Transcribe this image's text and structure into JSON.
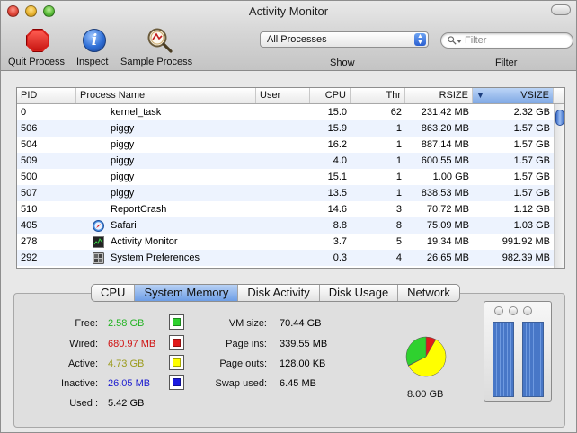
{
  "window": {
    "title": "Activity Monitor"
  },
  "toolbar": {
    "quit_label": "Quit Process",
    "inspect_label": "Inspect",
    "sample_label": "Sample Process",
    "show_selected": "All Processes",
    "show_label": "Show",
    "search_placeholder": "Filter",
    "filter_label": "Filter"
  },
  "table": {
    "columns": [
      "PID",
      "Process Name",
      "User",
      "CPU",
      "Thr",
      "RSIZE",
      "VSIZE"
    ],
    "sorted_column": "VSIZE",
    "rows": [
      {
        "pid": "0",
        "name": "kernel_task",
        "user": "",
        "cpu": "15.0",
        "thr": "62",
        "rsize": "231.42 MB",
        "vsize": "2.32 GB",
        "icon": ""
      },
      {
        "pid": "506",
        "name": "piggy",
        "user": "",
        "cpu": "15.9",
        "thr": "1",
        "rsize": "863.20 MB",
        "vsize": "1.57 GB",
        "icon": ""
      },
      {
        "pid": "504",
        "name": "piggy",
        "user": "",
        "cpu": "16.2",
        "thr": "1",
        "rsize": "887.14 MB",
        "vsize": "1.57 GB",
        "icon": ""
      },
      {
        "pid": "509",
        "name": "piggy",
        "user": "",
        "cpu": "4.0",
        "thr": "1",
        "rsize": "600.55 MB",
        "vsize": "1.57 GB",
        "icon": ""
      },
      {
        "pid": "500",
        "name": "piggy",
        "user": "",
        "cpu": "15.1",
        "thr": "1",
        "rsize": "1.00 GB",
        "vsize": "1.57 GB",
        "icon": ""
      },
      {
        "pid": "507",
        "name": "piggy",
        "user": "",
        "cpu": "13.5",
        "thr": "1",
        "rsize": "838.53 MB",
        "vsize": "1.57 GB",
        "icon": ""
      },
      {
        "pid": "510",
        "name": "ReportCrash",
        "user": "",
        "cpu": "14.6",
        "thr": "3",
        "rsize": "70.72 MB",
        "vsize": "1.12 GB",
        "icon": ""
      },
      {
        "pid": "405",
        "name": "Safari",
        "user": "",
        "cpu": "8.8",
        "thr": "8",
        "rsize": "75.09 MB",
        "vsize": "1.03 GB",
        "icon": "compass-icon"
      },
      {
        "pid": "278",
        "name": "Activity Monitor",
        "user": "",
        "cpu": "3.7",
        "thr": "5",
        "rsize": "19.34 MB",
        "vsize": "991.92 MB",
        "icon": "monitor-icon"
      },
      {
        "pid": "292",
        "name": "System Preferences",
        "user": "",
        "cpu": "0.3",
        "thr": "4",
        "rsize": "26.65 MB",
        "vsize": "982.39 MB",
        "icon": "prefs-icon"
      }
    ]
  },
  "tabs": [
    {
      "label": "CPU",
      "active": false
    },
    {
      "label": "System Memory",
      "active": true
    },
    {
      "label": "Disk Activity",
      "active": false
    },
    {
      "label": "Disk Usage",
      "active": false
    },
    {
      "label": "Network",
      "active": false
    }
  ],
  "memory": {
    "free": {
      "label": "Free:",
      "value": "2.58 GB",
      "color": "#22b322"
    },
    "wired": {
      "label": "Wired:",
      "value": "680.97 MB",
      "color": "#d01010"
    },
    "active": {
      "label": "Active:",
      "value": "4.73 GB",
      "color": "#9b9b1a"
    },
    "inactive": {
      "label": "Inactive:",
      "value": "26.05 MB",
      "color": "#1a1acf"
    },
    "used": {
      "label": "Used :",
      "value": "5.42 GB"
    },
    "vm_size": {
      "label": "VM size:",
      "value": "70.44 GB"
    },
    "page_ins": {
      "label": "Page ins:",
      "value": "339.55 MB"
    },
    "page_outs": {
      "label": "Page outs:",
      "value": "128.00 KB"
    },
    "swap_used": {
      "label": "Swap used:",
      "value": "6.45 MB"
    },
    "total": "8.00 GB",
    "swatch_colors": {
      "free": "#2fd12f",
      "wired": "#e01a1a",
      "active": "#ffff00",
      "inactive": "#1a1ae0"
    },
    "pie": {
      "free_fraction": 0.322,
      "wired_fraction": 0.083,
      "active_fraction": 0.591,
      "inactive_fraction": 0.004
    }
  }
}
